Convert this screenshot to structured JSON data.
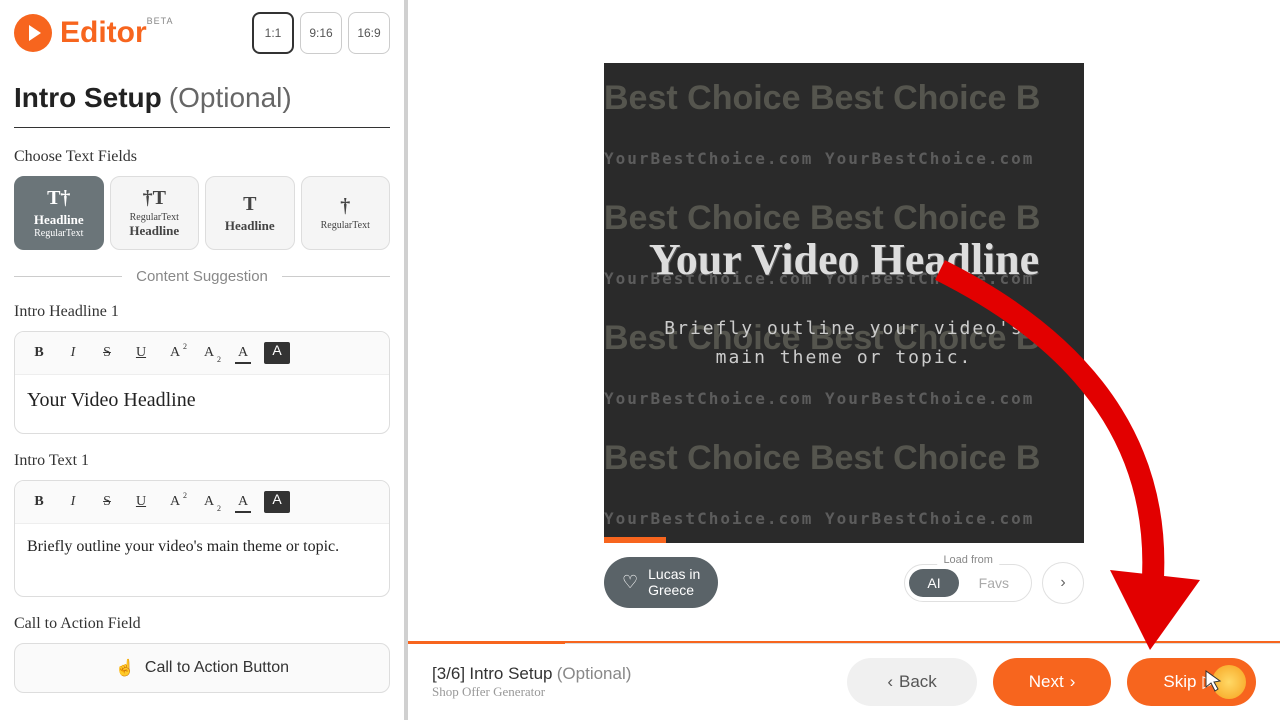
{
  "logo": {
    "text": "Editor",
    "badge": "BETA"
  },
  "ratios": {
    "r1": "1:1",
    "r2": "9:16",
    "r3": "16:9"
  },
  "section": {
    "title": "Intro Setup",
    "optional": "(Optional)"
  },
  "labels": {
    "choose": "Choose Text Fields",
    "headline1": "Intro Headline 1",
    "text1": "Intro Text 1",
    "cta": "Call to Action Field",
    "suggestion": "Content Suggestion",
    "ctaBtn": "Call to Action Button"
  },
  "fieldTypes": {
    "t1": {
      "icon": "T†",
      "main": "Headline",
      "sub": "RegularText"
    },
    "t2": {
      "icon": "†T",
      "sub": "RegularText",
      "main": "Headline"
    },
    "t3": {
      "icon": "T",
      "main": "Headline"
    },
    "t4": {
      "icon": "†",
      "main": "RegularText"
    }
  },
  "inputs": {
    "headline": "Your Video Headline",
    "text": "Briefly outline your video's main theme or topic."
  },
  "preview": {
    "headline": "Your Video Headline",
    "text": "Briefly outline your video's main theme or topic.",
    "bg1": "Best Choice Best Choice B",
    "bg2": "YourBestChoice.com  YourBestChoice.com",
    "theme": {
      "line1": "Lucas in",
      "line2": "Greece"
    },
    "loadLabel": "Load from",
    "ai": "AI",
    "favs": "Favs"
  },
  "footer": {
    "step": "[3/6]",
    "title": "Intro Setup",
    "optional": "(Optional)",
    "sub": "Shop Offer Generator",
    "back": "Back",
    "next": "Next",
    "skip": "Skip"
  },
  "tools": {
    "b": "B",
    "i": "I",
    "s": "S",
    "u": "U",
    "a": "A"
  }
}
